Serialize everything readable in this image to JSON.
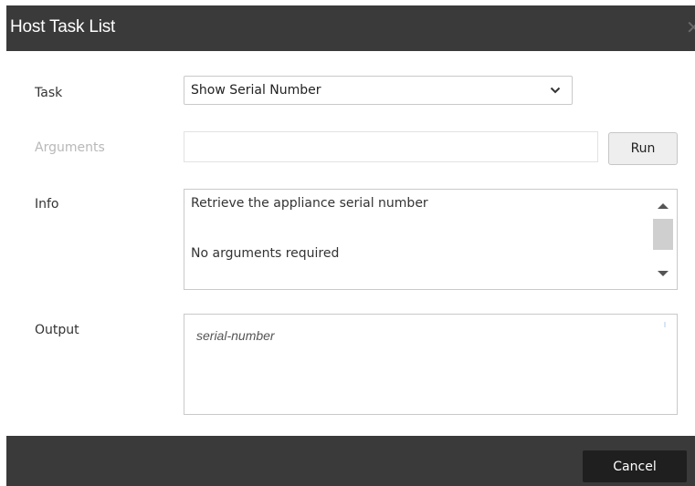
{
  "dialog": {
    "title": "Host Task List",
    "close_icon": "close-icon"
  },
  "form": {
    "task": {
      "label": "Task",
      "selected": "Show Serial Number",
      "icon": "chevron-down-icon"
    },
    "arguments": {
      "label": "Arguments",
      "value": "",
      "placeholder": ""
    },
    "run_button": {
      "label": "Run"
    },
    "info": {
      "label": "Info",
      "lines": [
        "Retrieve the appliance serial number",
        "No arguments required"
      ]
    },
    "output": {
      "label": "Output",
      "text": "serial-number"
    }
  },
  "footer": {
    "cancel_label": "Cancel"
  },
  "colors": {
    "titlebar": "#3a3a3a",
    "footer": "#3a3a3a",
    "cancel_button": "#1f1f1f",
    "disabled_label": "#b8b8b8"
  }
}
